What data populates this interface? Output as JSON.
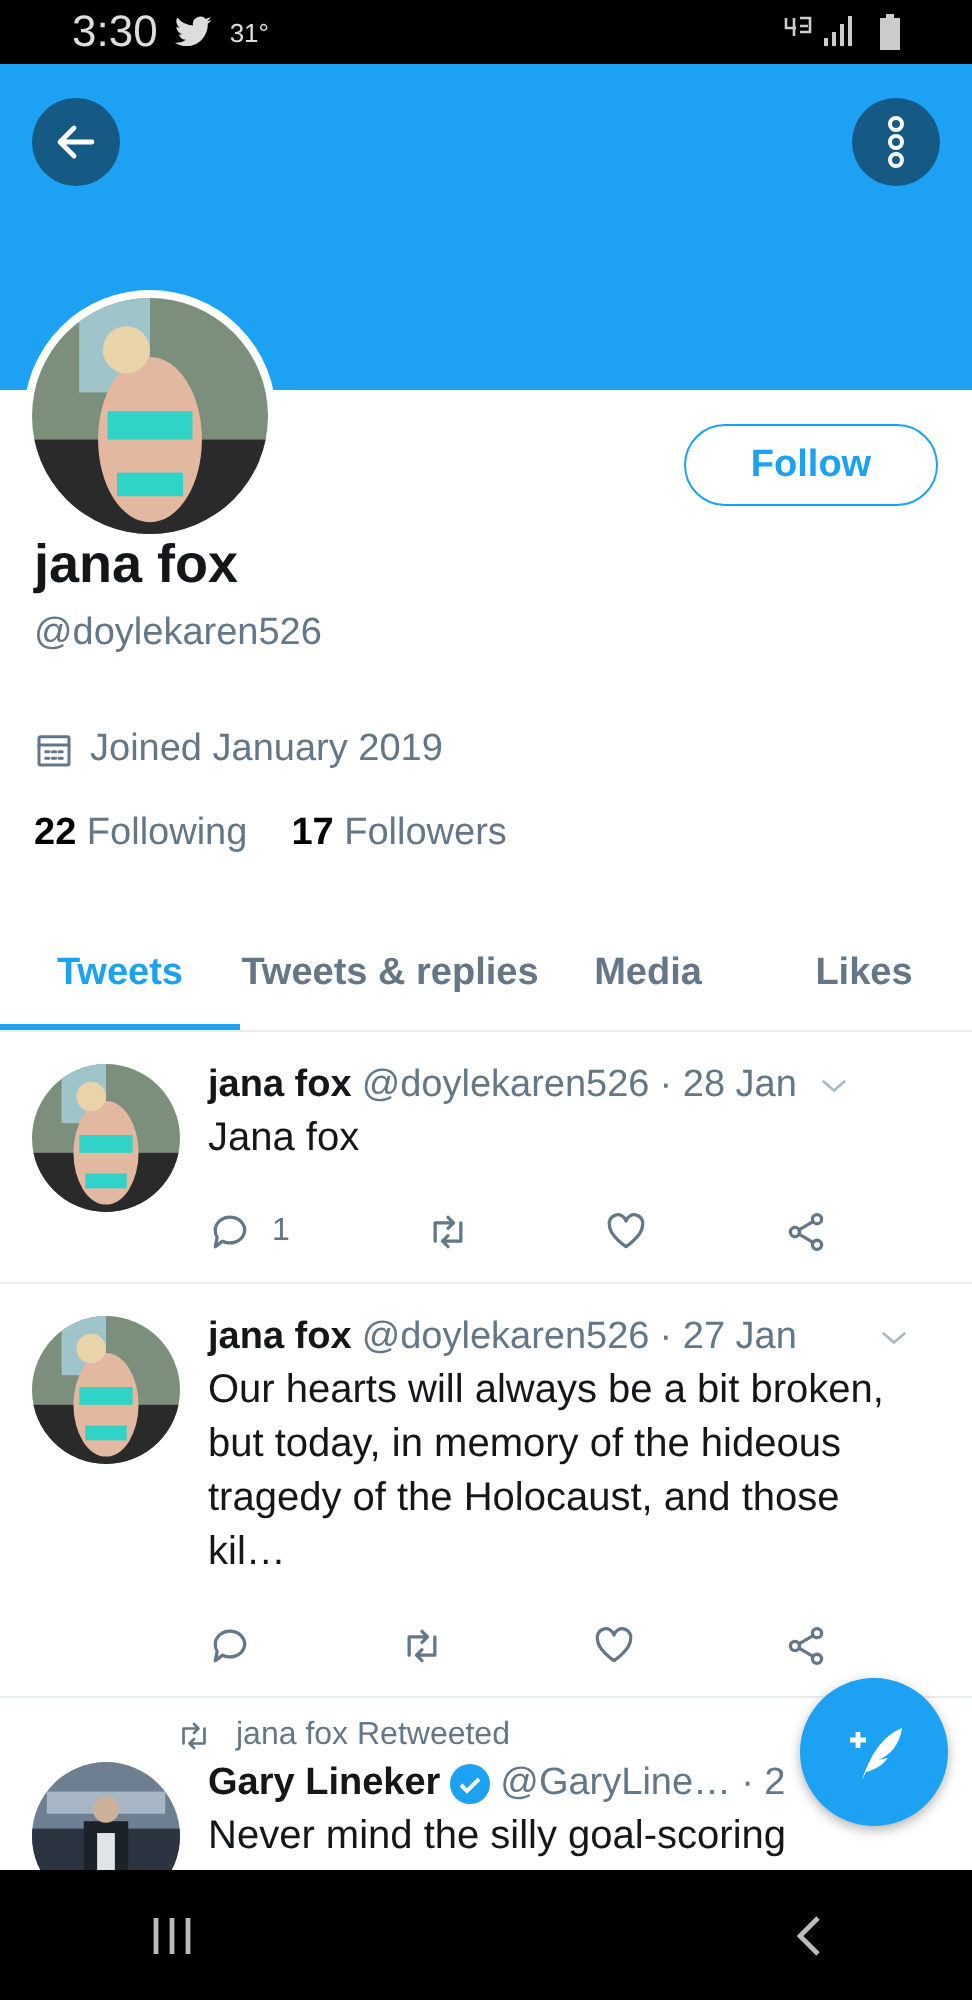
{
  "status_bar": {
    "time": "3:30",
    "temperature": "31°"
  },
  "profile": {
    "name": "jana fox",
    "handle": "@doylekaren526",
    "joined": "Joined January 2019",
    "following_count": "22",
    "following_label": "Following",
    "followers_count": "17",
    "followers_label": "Followers",
    "follow_button": "Follow"
  },
  "tabs": [
    {
      "label": "Tweets",
      "selected": true
    },
    {
      "label": "Tweets & replies",
      "selected": false
    },
    {
      "label": "Media",
      "selected": false
    },
    {
      "label": "Likes",
      "selected": false
    }
  ],
  "tweets": [
    {
      "kind": "tweet",
      "name": "jana fox",
      "handle": "@doylekaren526",
      "date": "· 28 Jan",
      "text": "Jana fox",
      "replies": "1"
    },
    {
      "kind": "tweet",
      "name": "jana fox",
      "handle": "@doylekaren526",
      "date": "· 27 Jan",
      "text": "Our hearts will always be a bit broken, but today, in memory of the hideous tragedy of the Holocaust, and those kil…"
    },
    {
      "kind": "retweet",
      "retweeted_by": "jana fox Retweeted",
      "name": "Gary Lineker",
      "verified": true,
      "handle": "@GaryLine…",
      "date": "· 2",
      "text": "Never mind the silly goal-scoring"
    }
  ]
}
